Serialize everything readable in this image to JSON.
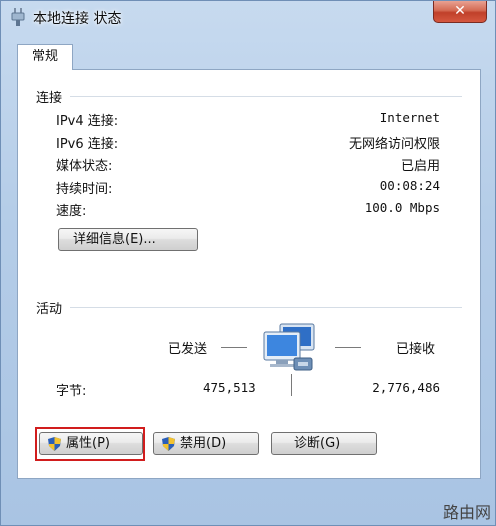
{
  "window": {
    "title": "本地连接 状态",
    "close_glyph": "✕"
  },
  "tabs": [
    {
      "label": "常规"
    }
  ],
  "connection": {
    "group_label": "连接",
    "rows": [
      {
        "label": "IPv4 连接:",
        "value": "Internet"
      },
      {
        "label": "IPv6 连接:",
        "value": "无网络访问权限"
      },
      {
        "label": "媒体状态:",
        "value": "已启用"
      },
      {
        "label": "持续时间:",
        "value": "00:08:24"
      },
      {
        "label": "速度:",
        "value": "100.0 Mbps"
      }
    ],
    "details_button": "详细信息(E)..."
  },
  "activity": {
    "group_label": "活动",
    "sent_label": "已发送",
    "received_label": "已接收",
    "bytes_label": "字节:",
    "bytes_sent": "475,513",
    "bytes_received": "2,776,486"
  },
  "buttons": {
    "properties": "属性(P)",
    "disable": "禁用(D)",
    "diagnose": "诊断(G)"
  },
  "watermark": "路由网",
  "colors": {
    "highlight_box": "#d11d1d",
    "close_button": "#c0402a"
  }
}
